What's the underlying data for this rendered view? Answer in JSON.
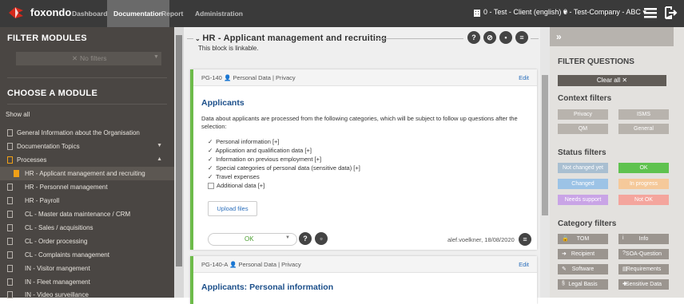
{
  "app": {
    "brand": "foxondo",
    "nav": [
      "Dashboard",
      "Documentation",
      "Report",
      "Administration"
    ],
    "active_nav": "Documentation",
    "client": "0 - Test - Client (english)",
    "company": "0 - Test-Company - ABC",
    "colors": {
      "topbar": "#3a3a3a",
      "sidebar": "#4a4643",
      "accent_orange": "#f0a017",
      "ok_green": "#6dbb4a"
    }
  },
  "sidebar": {
    "filter_heading": "FILTER MODULES",
    "filter_value": "No filters",
    "choose_heading": "CHOOSE A MODULE",
    "show_all": "Show all",
    "items": [
      {
        "label": "General Information about the Organisation"
      },
      {
        "label": "Documentation Topics"
      },
      {
        "label": "Processes"
      },
      {
        "label": "HR - Applicant management and recruiting"
      },
      {
        "label": "HR - Personnel management"
      },
      {
        "label": "HR - Payroll"
      },
      {
        "label": "CL - Master data maintenance / CRM"
      },
      {
        "label": "CL - Sales / acquisitions"
      },
      {
        "label": "CL - Order processing"
      },
      {
        "label": "CL - Complaints management"
      },
      {
        "label": "IN - Visitor mangement"
      },
      {
        "label": "IN - Fleet management"
      },
      {
        "label": "IN - Video surveillance"
      }
    ]
  },
  "main": {
    "block_title": "HR - Applicant management and recruiting",
    "block_sub": "This block is linkable.",
    "card1": {
      "ref": "PG-140",
      "tags": "Personal Data | Privacy",
      "edit": "Edit",
      "title": "Applicants",
      "text": "Data about applicants are processed from the following categories, which will be subject to follow up questions after the selection:",
      "options": [
        {
          "label": "Personal information [+]",
          "checked": true
        },
        {
          "label": "Application and qualification data [+]",
          "checked": true
        },
        {
          "label": "Information on previous employment [+]",
          "checked": true
        },
        {
          "label": "Special categories of personal data (sensitive data) [+]",
          "checked": true
        },
        {
          "label": "Travel expenses",
          "checked": true
        },
        {
          "label": "Additional data [+]",
          "checked": false
        }
      ],
      "upload": "Upload files",
      "status": "OK",
      "author": "alef.voelkner, 18/08/2020"
    },
    "card2": {
      "ref": "PG-140-A",
      "tags": "Personal Data | Privacy",
      "edit": "Edit",
      "title": "Applicants: Personal information"
    }
  },
  "right": {
    "heading": "FILTER QUESTIONS",
    "clear_all": "Clear all ✕",
    "context_heading": "Context filters",
    "context": [
      "Privacy",
      "ISMS",
      "QM",
      "General"
    ],
    "status_heading": "Status filters",
    "status": [
      {
        "label": "Not changed yet",
        "color": "#a9bfd1"
      },
      {
        "label": "OK",
        "color": "#5fc24f"
      },
      {
        "label": "Changed",
        "color": "#9cc3e6"
      },
      {
        "label": "In progress",
        "color": "#f5c99a"
      },
      {
        "label": "Needs support",
        "color": "#c9a4e6"
      },
      {
        "label": "Not OK",
        "color": "#f4a59d"
      }
    ],
    "category_heading": "Category filters",
    "categories": [
      {
        "label": "TOM",
        "icon": "lock-icon"
      },
      {
        "label": "Info",
        "icon": "info-icon"
      },
      {
        "label": "Recipient",
        "icon": "send-icon"
      },
      {
        "label": "SOA-Question",
        "icon": "question-icon"
      },
      {
        "label": "Software",
        "icon": "wrench-icon"
      },
      {
        "label": "Requirements",
        "icon": "document-icon"
      },
      {
        "label": "Legal Basis",
        "icon": "paragraph-icon"
      },
      {
        "label": "Sensitive Data",
        "icon": "person-plus-icon"
      }
    ]
  }
}
